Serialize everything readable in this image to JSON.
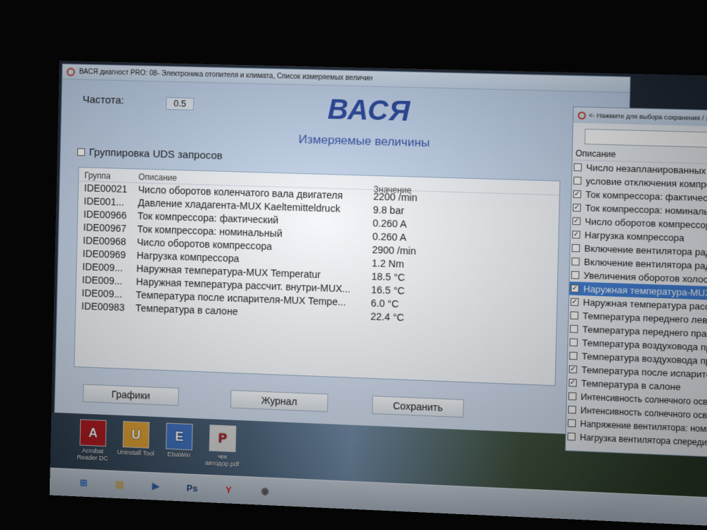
{
  "main_window": {
    "title": "ВАСЯ диагност PRO: 08- Электроника отопителя и климата,  Список измеряемых величин",
    "frequency_label": "Частота:",
    "frequency_value": "0.5",
    "brand": "ВАСЯ",
    "subtitle": "Измеряемые величины",
    "uds_grouping_label": "Группировка UDS запросов",
    "uds_grouping_checked": false
  },
  "table": {
    "headers": {
      "group": "Группа",
      "description": "Описание",
      "value": "Значение"
    },
    "rows": [
      {
        "group": "IDE00021",
        "description": "Число оборотов коленчатого вала двигателя",
        "value": "2200 /min"
      },
      {
        "group": "IDE001...",
        "description": "Давление хладагента-MUX Kaeltemitteldruck",
        "value": "9.8 bar"
      },
      {
        "group": "IDE00966",
        "description": "Ток компрессора: фактический",
        "value": "0.260 A"
      },
      {
        "group": "IDE00967",
        "description": "Ток компрессора: номинальный",
        "value": "0.260 A"
      },
      {
        "group": "IDE00968",
        "description": "Число оборотов компрессора",
        "value": "2900 /min"
      },
      {
        "group": "IDE00969",
        "description": "Нагрузка компрессора",
        "value": "1.2 Nm"
      },
      {
        "group": "IDE009...",
        "description": "Наружная температура-MUX Temperatur",
        "value": "18.5 °C"
      },
      {
        "group": "IDE009...",
        "description": "Наружная температура рассчит. внутри-MUX...",
        "value": "16.5 °C"
      },
      {
        "group": "IDE009...",
        "description": "Температура после испарителя-MUX Tempe...",
        "value": "6.0 °C"
      },
      {
        "group": "IDE00983",
        "description": "Температура в салоне",
        "value": "22.4 °C"
      }
    ]
  },
  "buttons": {
    "graphs": "Графики",
    "journal": "Журнал",
    "save": "Сохранить"
  },
  "side_window": {
    "title": "<- Нажмите для выбора сохранения / заг",
    "header": "Описание",
    "items": [
      {
        "label": "Число незапланированных пе",
        "checked": false,
        "selected": false
      },
      {
        "label": "условие отключения компрес",
        "checked": false,
        "selected": false
      },
      {
        "label": "Ток компрессора: фактический",
        "checked": true,
        "selected": false
      },
      {
        "label": "Ток компрессора: номинальны",
        "checked": true,
        "selected": false
      },
      {
        "label": "Число оборотов компрессора",
        "checked": true,
        "selected": false
      },
      {
        "label": "Нагрузка компрессора",
        "checked": true,
        "selected": false
      },
      {
        "label": "Включение вентилятора радиат",
        "checked": false,
        "selected": false
      },
      {
        "label": "Включение вентилятора радиато",
        "checked": false,
        "selected": false
      },
      {
        "label": "Увеличения оборотов холостого х",
        "checked": false,
        "selected": false
      },
      {
        "label": "Наружная температура-MUX Temp",
        "checked": true,
        "selected": true
      },
      {
        "label": "Наружная температура рассчит. вн",
        "checked": true,
        "selected": false
      },
      {
        "label": "Температура переднего левого де",
        "checked": false,
        "selected": false
      },
      {
        "label": "Температура переднего правого де",
        "checked": false,
        "selected": false
      },
      {
        "label": "Температура воздуховода пр-ва дл",
        "checked": false,
        "selected": false
      },
      {
        "label": "Температура воздуховода пр-ва дл",
        "checked": false,
        "selected": false
      },
      {
        "label": "Температура после испарителя-MU",
        "checked": true,
        "selected": false
      },
      {
        "label": "Температура в салоне",
        "checked": true,
        "selected": false
      },
      {
        "label": "Интенсивность солнечного освеще...",
        "checked": false,
        "selected": false
      },
      {
        "label": "Интенсивность солнечного освеще...",
        "checked": false,
        "selected": false
      },
      {
        "label": "Напряжение вентилятора: номинал...",
        "checked": false,
        "selected": false
      },
      {
        "label": "Нагрузка вентилятора спереди",
        "checked": false,
        "selected": false
      }
    ]
  },
  "desktop_icons": [
    {
      "label": "Acrobat Reader DC",
      "glyph": "A",
      "color": "#b0151c"
    },
    {
      "label": "Uninstall Tool",
      "glyph": "U",
      "color": "#e0a030"
    },
    {
      "label": "ElsaWin",
      "glyph": "E",
      "color": "#3a6fc2"
    },
    {
      "label": "чек автодор.pdf",
      "glyph": "P",
      "color": "#d8d8d8"
    }
  ],
  "taskbar": {
    "items": [
      {
        "name": "start-icon",
        "glyph": "⊞"
      },
      {
        "name": "explorer-icon",
        "glyph": "▤"
      },
      {
        "name": "media-icon",
        "glyph": "▶"
      },
      {
        "name": "photoshop-icon",
        "glyph": "Ps"
      },
      {
        "name": "yandex-icon",
        "glyph": "Y"
      },
      {
        "name": "vasya-icon",
        "glyph": "◉"
      }
    ]
  }
}
